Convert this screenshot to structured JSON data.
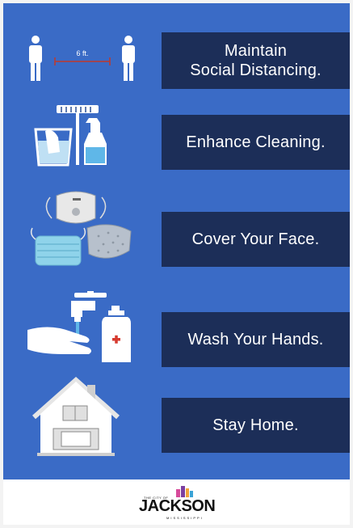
{
  "poster": {
    "items": [
      {
        "line1": "Maintain",
        "line2": "Social Distancing.",
        "icon": "social-distance-icon"
      },
      {
        "line1": "Enhance Cleaning.",
        "line2": "",
        "icon": "cleaning-supplies-icon"
      },
      {
        "line1": "Cover Your Face.",
        "line2": "",
        "icon": "face-masks-icon"
      },
      {
        "line1": "Wash Your Hands.",
        "line2": "",
        "icon": "hand-washing-icon"
      },
      {
        "line1": "Stay Home.",
        "line2": "",
        "icon": "house-icon"
      }
    ],
    "distance_label": "6 ft."
  },
  "footer": {
    "logo_top": "THE CITY OF",
    "logo_name": "JACKSON",
    "logo_state": "MISSISSIPPI"
  },
  "colors": {
    "background": "#3a6bc6",
    "banner": "#1c2e58",
    "text": "#ffffff"
  }
}
